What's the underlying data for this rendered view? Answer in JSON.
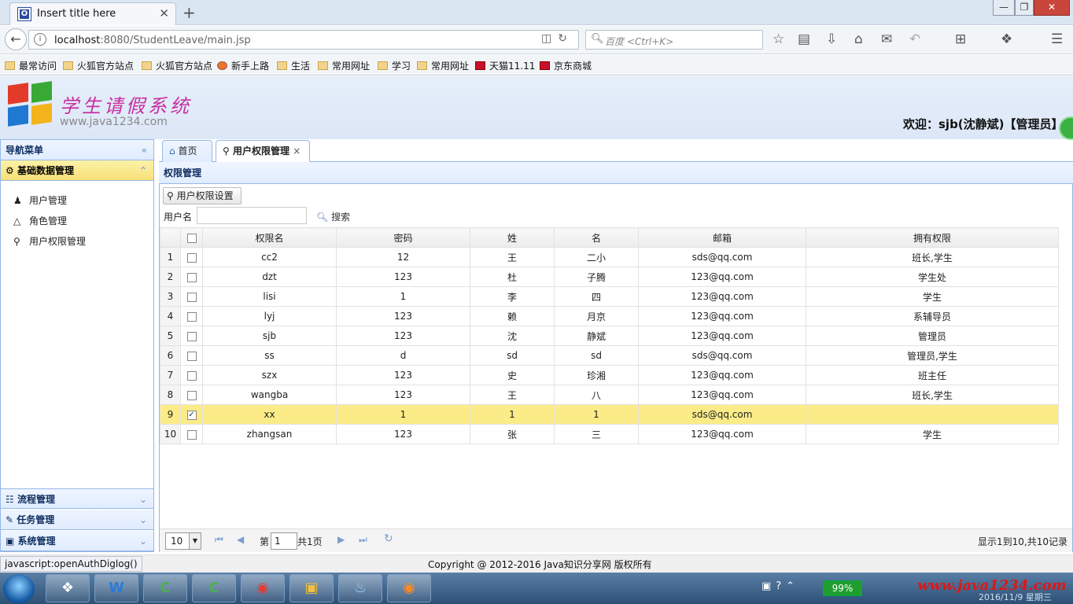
{
  "browser": {
    "tab_title": "Insert title here",
    "tab_icon_letter": "O",
    "tab_close": "✕",
    "new_tab": "+",
    "url_host": "localhost",
    "url_rest": ":8080/StudentLeave/main.jsp",
    "search_placeholder": "百度 <Ctrl+K>",
    "window_min": "—",
    "window_max": "❐",
    "window_close": "✕",
    "bookmarks": [
      "最常访问",
      "火狐官方站点",
      "火狐官方站点",
      "新手上路",
      "生活",
      "常用网址",
      "学习",
      "常用网址",
      "天猫11.11",
      "京东商城"
    ]
  },
  "app": {
    "logo_text": "学生请假系统",
    "logo_url": "www.java1234.com",
    "welcome": "欢迎：sjb(沈静斌)【管理员】"
  },
  "sidebar": {
    "title": "导航菜单",
    "collapse": "«",
    "sections": [
      {
        "label": "基础数据管理",
        "active": true
      },
      {
        "label": "流程管理"
      },
      {
        "label": "任务管理"
      },
      {
        "label": "系统管理"
      }
    ],
    "items": [
      {
        "label": "用户管理",
        "icon": "users-icon"
      },
      {
        "label": "角色管理",
        "icon": "role-icon"
      },
      {
        "label": "用户权限管理",
        "icon": "key-icon"
      }
    ]
  },
  "tabs": [
    {
      "label": "首页",
      "icon": "home-icon"
    },
    {
      "label": "用户权限管理",
      "icon": "key-icon",
      "close": "×"
    }
  ],
  "panel": {
    "title": "权限管理",
    "auth_button": "用户权限设置",
    "username_label": "用户名",
    "username_value": "",
    "search_button": "搜索"
  },
  "table": {
    "headers": [
      "权限名",
      "密码",
      "姓",
      "名",
      "邮箱",
      "拥有权限"
    ],
    "rows": [
      {
        "n": "1",
        "checked": false,
        "c": [
          "cc2",
          "12",
          "王",
          "二小",
          "sds@qq.com",
          "班长,学生"
        ]
      },
      {
        "n": "2",
        "checked": false,
        "c": [
          "dzt",
          "123",
          "杜",
          "子腾",
          "123@qq.com",
          "学生处"
        ]
      },
      {
        "n": "3",
        "checked": false,
        "c": [
          "lisi",
          "1",
          "李",
          "四",
          "123@qq.com",
          "学生"
        ]
      },
      {
        "n": "4",
        "checked": false,
        "c": [
          "lyj",
          "123",
          "赖",
          "月京",
          "123@qq.com",
          "系辅导员"
        ]
      },
      {
        "n": "5",
        "checked": false,
        "c": [
          "sjb",
          "123",
          "沈",
          "静斌",
          "123@qq.com",
          "管理员"
        ]
      },
      {
        "n": "6",
        "checked": false,
        "c": [
          "ss",
          "d",
          "sd",
          "sd",
          "sds@qq.com",
          "管理员,学生"
        ]
      },
      {
        "n": "7",
        "checked": false,
        "c": [
          "szx",
          "123",
          "史",
          "珍湘",
          "123@qq.com",
          "班主任"
        ]
      },
      {
        "n": "8",
        "checked": false,
        "c": [
          "wangba",
          "123",
          "王",
          "八",
          "123@qq.com",
          "班长,学生"
        ]
      },
      {
        "n": "9",
        "checked": true,
        "c": [
          "xx",
          "1",
          "1",
          "1",
          "sds@qq.com",
          ""
        ]
      },
      {
        "n": "10",
        "checked": false,
        "c": [
          "zhangsan",
          "123",
          "张",
          "三",
          "123@qq.com",
          "学生"
        ]
      }
    ]
  },
  "pager": {
    "page_size": "10",
    "page_prefix": "第",
    "page_value": "1",
    "page_total": "共1页",
    "summary": "显示1到10,共10记录"
  },
  "status": {
    "link": "javascript:openAuthDiglog()",
    "copyright": "Copyright @ 2012-2016 Java知识分享网 版权所有"
  },
  "taskbar": {
    "battery": "99%",
    "watermark": "www.java1234.com",
    "date": "2016/11/9 星期三"
  },
  "colors": {
    "accent": "#95b8e7",
    "selected_row": "#fbec88",
    "logo_text": "#c72fa0"
  }
}
